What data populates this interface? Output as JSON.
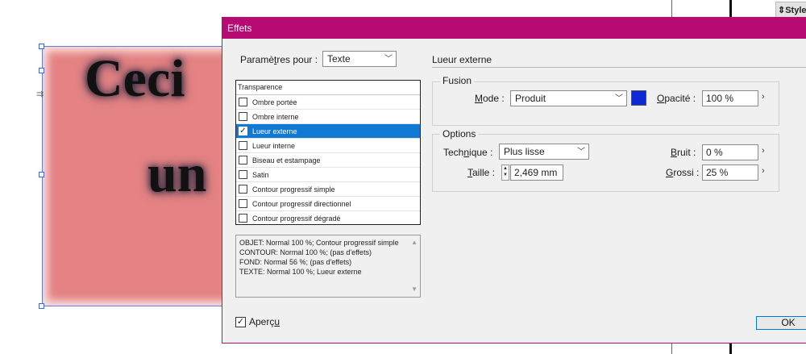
{
  "canvas": {
    "text_line1": "Ceci",
    "text_line2": "un",
    "styles_tab": "Style",
    "styles_icon": "updown-arrows-icon"
  },
  "dialog": {
    "title": "Effets",
    "params_label_before": "Paramè",
    "params_label_underline": "t",
    "params_label_after": "res pour :",
    "params_value": "Texte",
    "list_header": "Transparence",
    "effects": [
      {
        "label": "Ombre portée",
        "checked": false,
        "selected": false
      },
      {
        "label": "Ombre interne",
        "checked": false,
        "selected": false
      },
      {
        "label": "Lueur externe",
        "checked": true,
        "selected": true
      },
      {
        "label": "Lueur interne",
        "checked": false,
        "selected": false
      },
      {
        "label": "Biseau et estampage",
        "checked": false,
        "selected": false
      },
      {
        "label": "Satin",
        "checked": false,
        "selected": false
      },
      {
        "label": "Contour progressif simple",
        "checked": false,
        "selected": false
      },
      {
        "label": "Contour progressif directionnel",
        "checked": false,
        "selected": false
      },
      {
        "label": "Contour progressif dégradé",
        "checked": false,
        "selected": false
      }
    ],
    "summary": [
      "OBJET: Normal 100 %; Contour progressif simple",
      "CONTOUR: Normal 100 %; (pas d'effets)",
      "FOND: Normal 56 %; (pas d'effets)",
      "TEXTE: Normal 100 %; Lueur externe"
    ],
    "apercu_before": "Aperç",
    "apercu_underline": "u",
    "apercu_checked": true,
    "section_title": "Lueur externe",
    "fusion": {
      "group_label": "Fusion",
      "mode_label_underline": "M",
      "mode_label_rest": "ode :",
      "mode_value": "Produit",
      "color_swatch": "#0f29d6",
      "opacity_label_underline": "O",
      "opacity_label_rest": "pacité :",
      "opacity_value": "100 %"
    },
    "options": {
      "group_label": "Options",
      "technique_label_before": "Tech",
      "technique_label_underline": "n",
      "technique_label_after": "ique :",
      "technique_value": "Plus lisse",
      "taille_label_underline": "T",
      "taille_label_rest": "aille :",
      "taille_value": "2,469 mm",
      "bruit_label_underline": "B",
      "bruit_label_rest": "ruit :",
      "bruit_value": "0 %",
      "grossi_label_underline": "G",
      "grossi_label_rest": "rossi :",
      "grossi_value": "25 %"
    },
    "ok_label": "OK"
  }
}
